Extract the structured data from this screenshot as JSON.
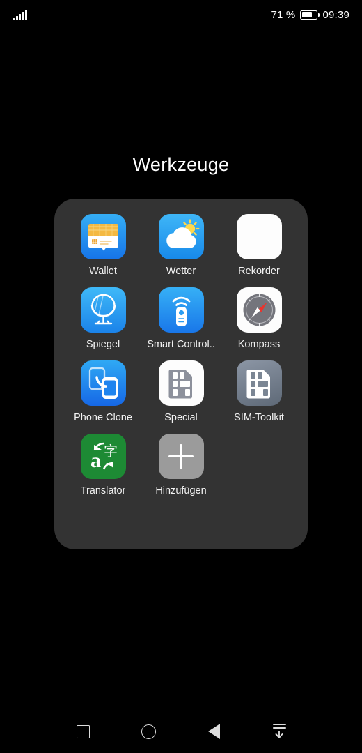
{
  "status_bar": {
    "signal_icon": "signal-bars-icon",
    "battery_percent": "71 %",
    "battery_fill_ratio": 0.71,
    "battery_icon": "battery-icon",
    "clock": "09:39"
  },
  "folder": {
    "title": "Werkzeuge",
    "apps": [
      {
        "label": "Wallet",
        "icon": "wallet-icon",
        "style": "ic-wallet"
      },
      {
        "label": "Wetter",
        "icon": "weather-icon",
        "style": "ic-wetter"
      },
      {
        "label": "Rekorder",
        "icon": "recorder-icon",
        "style": "ic-white"
      },
      {
        "label": "Spiegel",
        "icon": "mirror-icon",
        "style": "ic-spiegel"
      },
      {
        "label": "Smart Control..",
        "icon": "smart-control-icon",
        "style": "ic-smart"
      },
      {
        "label": "Kompass",
        "icon": "compass-icon",
        "style": "ic-white"
      },
      {
        "label": "Phone Clone",
        "icon": "phone-clone-icon",
        "style": "ic-clone"
      },
      {
        "label": "Special",
        "icon": "sim-card-icon",
        "style": "ic-white"
      },
      {
        "label": "SIM-Toolkit",
        "icon": "sim-toolkit-icon",
        "style": "ic-simtk"
      },
      {
        "label": "Translator",
        "icon": "translator-icon",
        "style": "ic-transl"
      },
      {
        "label": "Hinzufügen",
        "icon": "add-plus-icon",
        "style": "ic-add"
      }
    ]
  },
  "nav_bar": {
    "recents": "recents-square-icon",
    "home": "home-circle-icon",
    "back": "back-triangle-icon",
    "hide": "hide-navbar-icon"
  },
  "colors": {
    "screen_background": "#000000",
    "folder_panel": "#333333",
    "label_text": "#f2f2f2",
    "accent_blue": "#1789ea",
    "translator_green": "#1d8a34",
    "add_gray": "#9b9b9b"
  }
}
